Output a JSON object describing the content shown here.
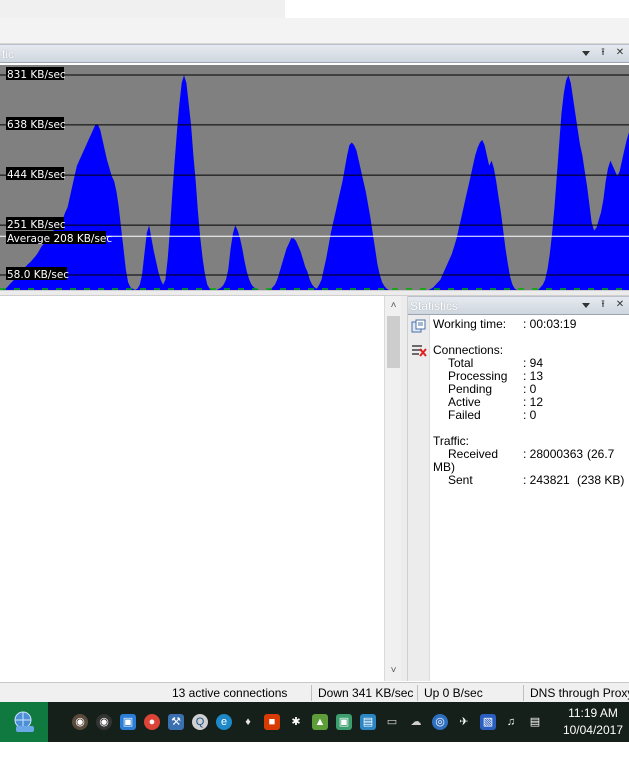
{
  "graph_panel": {
    "title": "tic",
    "scale_labels": [
      "831 KB/sec",
      "638 KB/sec",
      "444 KB/sec",
      "251 KB/sec",
      "58.0 KB/sec"
    ],
    "average_label": "Average 208 KB/sec"
  },
  "chart_data": {
    "type": "area",
    "title": "",
    "ylabel": "",
    "xlabel": "",
    "ylim": [
      0,
      831
    ],
    "y_ticks": [
      831,
      638,
      444,
      251,
      58
    ],
    "average": 208,
    "unit": "KB/sec",
    "color": "#0000ff",
    "grid": true,
    "values": [
      0,
      0,
      5,
      10,
      20,
      30,
      40,
      50,
      60,
      70,
      80,
      90,
      100,
      108,
      118,
      128,
      140,
      155,
      170,
      180,
      190,
      205,
      220,
      230,
      240,
      250,
      260,
      275,
      300,
      320,
      360,
      400,
      440,
      480,
      500,
      520,
      540,
      560,
      580,
      600,
      620,
      640,
      640,
      620,
      580,
      540,
      500,
      470,
      440,
      420,
      380,
      320,
      240,
      160,
      80,
      30,
      10,
      5,
      0,
      5,
      20,
      60,
      140,
      220,
      250,
      200,
      150,
      110,
      70,
      40,
      20,
      40,
      120,
      240,
      380,
      500,
      620,
      720,
      800,
      830,
      800,
      720,
      640,
      520,
      420,
      300,
      200,
      120,
      60,
      20,
      5,
      0,
      0,
      0,
      5,
      10,
      20,
      40,
      80,
      160,
      220,
      250,
      230,
      200,
      160,
      110,
      70,
      40,
      20,
      10,
      5,
      0,
      0,
      0,
      0,
      0,
      5,
      10,
      20,
      40,
      70,
      100,
      130,
      160,
      180,
      200,
      200,
      190,
      170,
      150,
      120,
      90,
      70,
      40,
      20,
      10,
      5,
      20,
      40,
      80,
      120,
      170,
      220,
      260,
      300,
      340,
      380,
      420,
      470,
      520,
      560,
      570,
      560,
      540,
      500,
      460,
      420,
      380,
      330,
      280,
      220,
      160,
      100,
      60,
      30,
      15,
      5,
      0,
      0,
      0,
      0,
      0,
      0,
      0,
      0,
      0,
      0,
      0,
      0,
      0,
      0,
      0,
      0,
      0,
      0,
      5,
      10,
      20,
      30,
      40,
      60,
      80,
      100,
      120,
      140,
      170,
      200,
      240,
      280,
      320,
      360,
      400,
      440,
      480,
      520,
      550,
      570,
      580,
      560,
      520,
      480,
      500,
      470,
      420,
      360,
      300,
      230,
      160,
      100,
      50,
      20,
      5,
      0,
      0,
      0,
      0,
      0,
      0,
      0,
      0,
      0,
      0,
      10,
      20,
      40,
      80,
      140,
      220,
      320,
      440,
      560,
      680,
      760,
      810,
      830,
      800,
      740,
      680,
      620,
      560,
      520,
      460,
      400,
      330,
      260,
      230,
      240,
      270,
      300,
      350,
      420,
      470,
      500,
      480,
      460,
      440,
      460,
      500,
      540,
      580,
      610
    ]
  },
  "statistics": {
    "title": "Statistics",
    "working_time_label": "Working time:",
    "working_time_value": ": 00:03:19",
    "connections_label": "Connections:",
    "total_label": "Total",
    "total_value": ": 94",
    "processing_label": "Processing",
    "processing_value": ": 13",
    "pending_label": "Pending",
    "pending_value": ": 0",
    "active_label": "Active",
    "active_value": ": 12",
    "failed_label": "Failed",
    "failed_value": ": 0",
    "traffic_label": "Traffic:",
    "received_label": "Received",
    "received_value": ": 28000363",
    "received_size": "(26.7",
    "received_size_wrap": "MB)",
    "sent_label": "Sent",
    "sent_value": ": 243821",
    "sent_size": "(238 KB)"
  },
  "statusbar": {
    "connections": "13 active connections",
    "down": "Down 341 KB/sec",
    "up": "Up 0 B/sec",
    "dns": "DNS through Proxy"
  },
  "taskbar": {
    "time": "11:19 AM",
    "date": "10/04/2017"
  },
  "colors": {
    "graph_fill": "#0000ff",
    "graph_bg": "#808080",
    "start_button": "#10793f",
    "taskbar": "#15201a"
  }
}
